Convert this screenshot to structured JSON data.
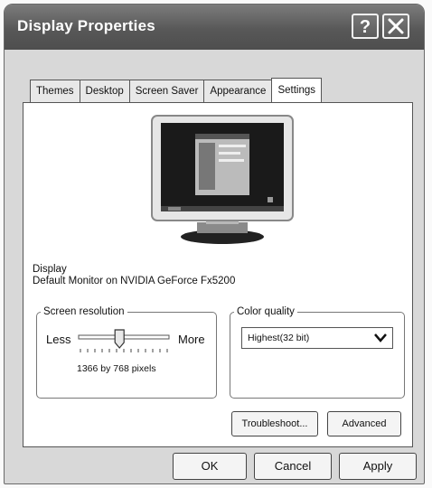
{
  "window": {
    "title": "Display Properties",
    "help_label": "?",
    "close_icon": "close-icon"
  },
  "tabs": [
    {
      "label": "Themes"
    },
    {
      "label": "Desktop"
    },
    {
      "label": "Screen Saver"
    },
    {
      "label": "Appearance"
    },
    {
      "label": "Settings"
    }
  ],
  "active_tab": "Settings",
  "display": {
    "label": "Display",
    "value": "Default Monitor on NVIDIA  GeForce Fx5200"
  },
  "resolution": {
    "legend": "Screen resolution",
    "less_label": "Less",
    "more_label": "More",
    "value_text": "1366 by 768 pixels",
    "slider_position": 0.45
  },
  "color_quality": {
    "legend": "Color quality",
    "selected": "Highest(32 bit)"
  },
  "buttons": {
    "troubleshoot": "Troubleshoot...",
    "advanced": "Advanced",
    "ok": "OK",
    "cancel": "Cancel",
    "apply": "Apply"
  }
}
